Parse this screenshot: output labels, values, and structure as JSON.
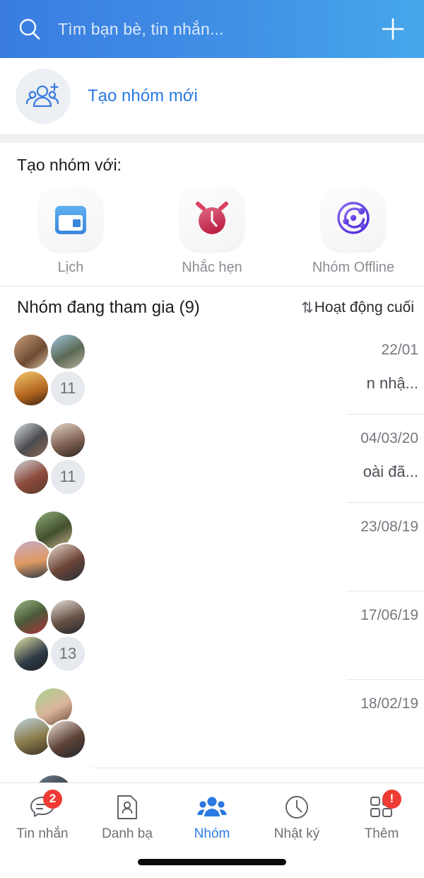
{
  "header": {
    "search_icon": "search-icon",
    "search_placeholder": "Tìm bạn bè, tin nhắn...",
    "add_icon": "plus-icon",
    "bg_start": "#3a7ce0",
    "bg_end": "#46a7ea"
  },
  "create_group": {
    "icon": "group-add-icon",
    "label": "Tạo nhóm mới",
    "accent": "#2a7ae2"
  },
  "create_with": {
    "title": "Tạo nhóm với:",
    "items": [
      {
        "label": "Lịch",
        "icon": "calendar-icon",
        "color": "#4a9bea"
      },
      {
        "label": "Nhắc hẹn",
        "icon": "alarm-clock-icon",
        "color": "#cf3b59"
      },
      {
        "label": "Nhóm Offline",
        "icon": "orbit-icon",
        "color": "#6140e0"
      }
    ]
  },
  "group_list": {
    "title": "Nhóm đang tham gia (9)",
    "sort_icon": "sort-updown-icon",
    "sort_label": "Hoạt động cuối",
    "rows": [
      {
        "date": "22/01",
        "snippet": "n nhậ...",
        "count": "11",
        "avatars": 4
      },
      {
        "date": "04/03/20",
        "snippet": "oài đã...",
        "count": "11",
        "avatars": 4
      },
      {
        "date": "23/08/19",
        "snippet": "",
        "count": "",
        "avatars": 3
      },
      {
        "date": "17/06/19",
        "snippet": "",
        "count": "13",
        "avatars": 4
      },
      {
        "date": "18/02/19",
        "snippet": "",
        "count": "",
        "avatars": 3
      }
    ]
  },
  "tabbar": {
    "items": [
      {
        "label": "Tin nhắn",
        "icon": "chat-bubble-icon",
        "badge": "2",
        "active": false
      },
      {
        "label": "Danh bạ",
        "icon": "contact-card-icon",
        "badge": "",
        "active": false
      },
      {
        "label": "Nhóm",
        "icon": "people-group-icon",
        "badge": "",
        "active": true
      },
      {
        "label": "Nhật ký",
        "icon": "clock-icon",
        "badge": "",
        "active": false
      },
      {
        "label": "Thêm",
        "icon": "grid-squares-icon",
        "badge": "!",
        "active": false
      }
    ],
    "active_color": "#2a7ae2",
    "badge_color": "#ee3b33"
  }
}
